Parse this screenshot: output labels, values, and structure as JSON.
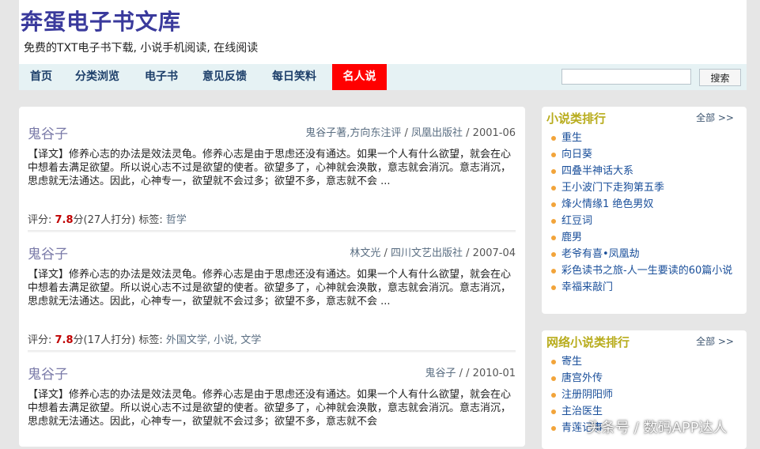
{
  "header": {
    "title": "奔蛋电子书文库",
    "subtitle": "免费的TXT电子书下载, 小说手机阅读, 在线阅读"
  },
  "nav": {
    "items": [
      "首页",
      "分类浏览",
      "电子书",
      "意见反馈",
      "每日笑料",
      "名人说"
    ],
    "active_index": 5,
    "search_placeholder": "",
    "search_label": "搜索"
  },
  "books": [
    {
      "title": "鬼谷子",
      "author": "鬼谷子著,方向东注评",
      "publisher": "凤凰出版社",
      "date": "2001-06",
      "desc": "【译文】修养心志的办法是效法灵龟。修养心志是由于思虑还没有通达。如果一个人有什么欲望，就会在心中想着去满足欲望。所以说心志不过是欲望的使者。欲望多了，心神就会涣散，意志就会消沉。意志消沉，思虑就无法通达。因此，心神专一，欲望就不会过多；欲望不多，意志就不会 ...",
      "rating_prefix": "评分: ",
      "score": "7.8",
      "rating_suffix": "分(27人打分) 标签: ",
      "tags": "哲学"
    },
    {
      "title": "鬼谷子",
      "author": "林文光",
      "publisher": "四川文艺出版社",
      "date": "2007-04",
      "desc": "【译文】修养心志的办法是效法灵龟。修养心志是由于思虑还没有通达。如果一个人有什么欲望，就会在心中想着去满足欲望。所以说心志不过是欲望的使者。欲望多了，心神就会涣散，意志就会消沉。意志消沉，思虑就无法通达。因此，心神专一，欲望就不会过多；欲望不多，意志就不会 ...",
      "rating_prefix": "评分: ",
      "score": "7.8",
      "rating_suffix": "分(17人打分) 标签: ",
      "tags": "外国文学, 小说, 文学"
    },
    {
      "title": "鬼谷子",
      "author": "鬼谷子",
      "publisher": "",
      "date": "2010-01",
      "desc": "【译文】修养心志的办法是效法灵龟。修养心志是由于思虑还没有通达。如果一个人有什么欲望，就会在心中想着去满足欲望。所以说心志不过是欲望的使者。欲望多了，心神就会涣散，意志就会消沉。意志消沉，思虑就无法通达。因此，心神专一，欲望就不会过多；欲望不多，意志就不会",
      "rating_prefix": "",
      "score": "",
      "rating_suffix": "",
      "tags": ""
    }
  ],
  "sep": " / ",
  "sidebar": {
    "novel_rank": {
      "title": "小说类排行",
      "more": "全部 >>",
      "items": [
        "重生",
        "向日葵",
        "四叠半神话大系",
        "王小波门下走狗第五季",
        "烽火情缘1 绝色男奴",
        "红豆词",
        "鹿男",
        "老爷有喜•凤凰劫",
        "彩色读书之旅-人一生要读的60篇小说",
        "幸福来敲门"
      ]
    },
    "web_rank": {
      "title": "网络小说类排行",
      "more": "全部 >>",
      "items": [
        "寄生",
        "唐宫外传",
        "注册阴阳师",
        "主治医生",
        "青莲记事"
      ]
    }
  },
  "watermark": "头条号 / 数码APP达人",
  "colors": {
    "nav_active": "#ff0000",
    "score": "#c00000",
    "panel_title": "#b8ac1c",
    "bullet": "#f2a43a"
  }
}
